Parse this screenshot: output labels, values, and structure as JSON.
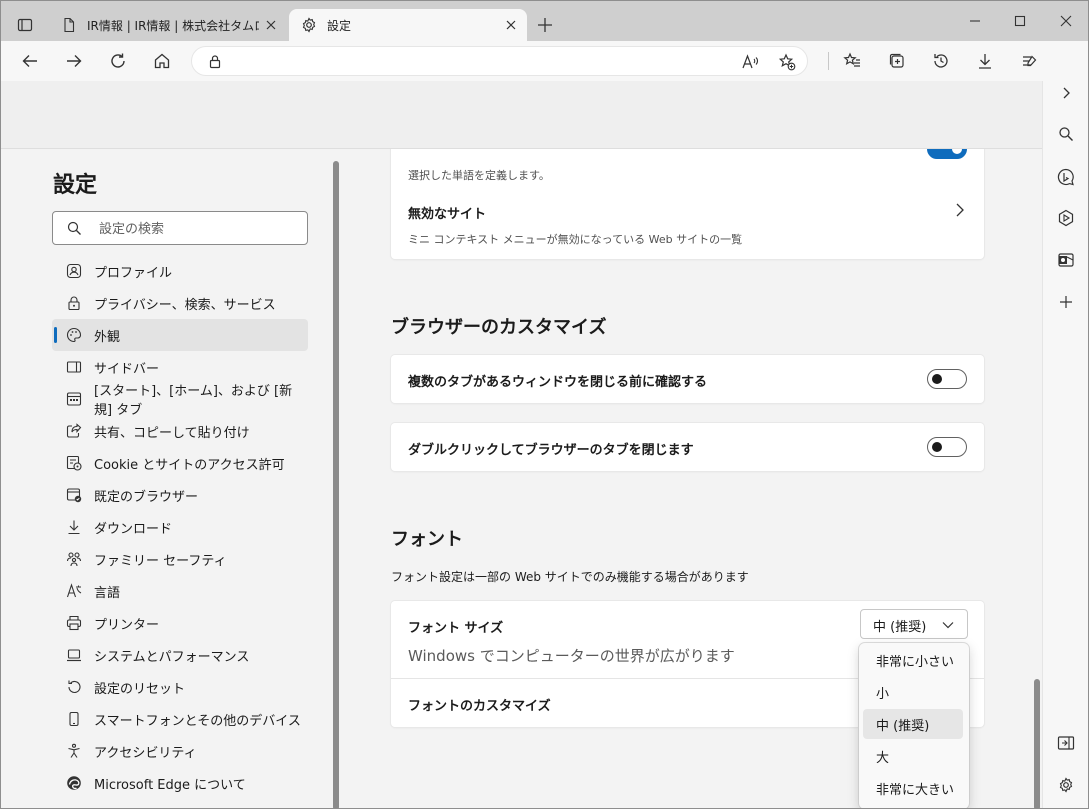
{
  "tabs": [
    {
      "label": "IR情報 | IR情報 | 株式会社タムロン",
      "icon": "page-icon",
      "active": false
    },
    {
      "label": "設定",
      "icon": "gear-icon",
      "active": true
    }
  ],
  "address": {
    "value": ""
  },
  "settings": {
    "title": "設定",
    "search_placeholder": "設定の検索",
    "nav": [
      {
        "label": "プロファイル",
        "icon": "profile-icon"
      },
      {
        "label": "プライバシー、検索、サービス",
        "icon": "lock-icon"
      },
      {
        "label": "外観",
        "icon": "palette-icon",
        "selected": true
      },
      {
        "label": "サイドバー",
        "icon": "sidebar-icon"
      },
      {
        "label": "[スタート]、[ホーム]、および [新規] タブ",
        "icon": "start-home-icon"
      },
      {
        "label": "共有、コピーして貼り付け",
        "icon": "share-icon"
      },
      {
        "label": "Cookie とサイトのアクセス許可",
        "icon": "cookie-icon"
      },
      {
        "label": "既定のブラウザー",
        "icon": "default-browser-icon"
      },
      {
        "label": "ダウンロード",
        "icon": "download-icon"
      },
      {
        "label": "ファミリー セーフティ",
        "icon": "family-icon"
      },
      {
        "label": "言語",
        "icon": "language-icon"
      },
      {
        "label": "プリンター",
        "icon": "printer-icon"
      },
      {
        "label": "システムとパフォーマンス",
        "icon": "laptop-icon"
      },
      {
        "label": "設定のリセット",
        "icon": "reset-icon"
      },
      {
        "label": "スマートフォンとその他のデバイス",
        "icon": "phone-icon"
      },
      {
        "label": "アクセシビリティ",
        "icon": "accessibility-icon"
      },
      {
        "label": "Microsoft Edge について",
        "icon": "edge-icon"
      }
    ]
  },
  "main": {
    "define_sub": "選択した単語を定義します。",
    "disabled_sites_title": "無効なサイト",
    "disabled_sites_sub": "ミニ コンテキスト メニューが無効になっている Web サイトの一覧",
    "customize_heading": "ブラウザーのカスタマイズ",
    "confirm_close_label": "複数のタブがあるウィンドウを閉じる前に確認する",
    "confirm_close_on": false,
    "dblclick_close_label": "ダブルクリックしてブラウザーのタブを閉じます",
    "dblclick_close_on": false,
    "font_heading": "フォント",
    "font_note": "フォント設定は一部の Web サイトでのみ機能する場合があります",
    "font_size_label": "フォント サイズ",
    "font_size_value": "中 (推奨)",
    "font_preview": "Windows でコンピューターの世界が広がります",
    "font_customize_label": "フォントのカスタマイズ",
    "font_size_options": [
      "非常に小さい",
      "小",
      "中 (推奨)",
      "大",
      "非常に大きい"
    ],
    "font_size_selected_index": 2
  },
  "colors": {
    "accent": "#0f6cbd"
  }
}
